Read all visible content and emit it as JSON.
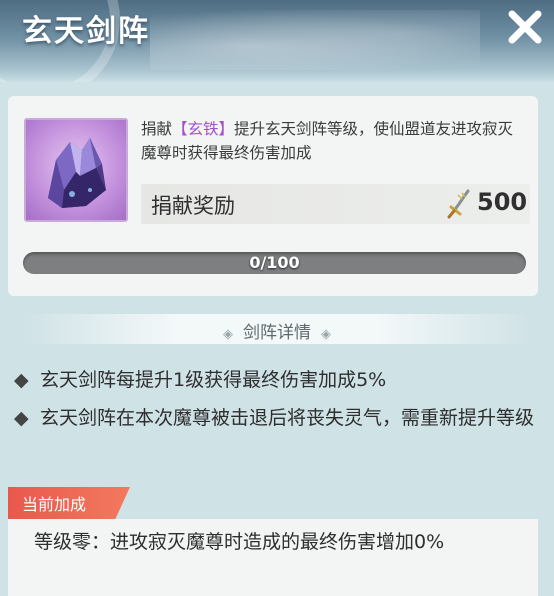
{
  "header": {
    "title": "玄天剑阵"
  },
  "donate": {
    "desc_prefix": "捐献",
    "item_name": "【玄铁】",
    "desc_suffix": "提升玄天剑阵等级，使仙盟道友进攻寂灭魔尊时获得最终伤害加成",
    "reward_label": "捐献奖励",
    "reward_icon": "sword-currency-icon",
    "reward_value": "500",
    "item_icon": "crystal-ore-icon"
  },
  "progress": {
    "text": "0/100",
    "fraction": 0
  },
  "details": {
    "title": "剑阵详情",
    "bullets": [
      "玄天剑阵每提升1级获得最终伤害加成5%",
      "玄天剑阵在本次魔尊被击退后将丧失灵气，需重新提升等级"
    ]
  },
  "current_bonus": {
    "badge": "当前加成",
    "text": "等级零：进攻寂灭魔尊时造成的最终伤害增加0%"
  },
  "colors": {
    "accent": "#a34fd0",
    "badge": "#ec5f50",
    "progress_track": "#7d7f80"
  }
}
